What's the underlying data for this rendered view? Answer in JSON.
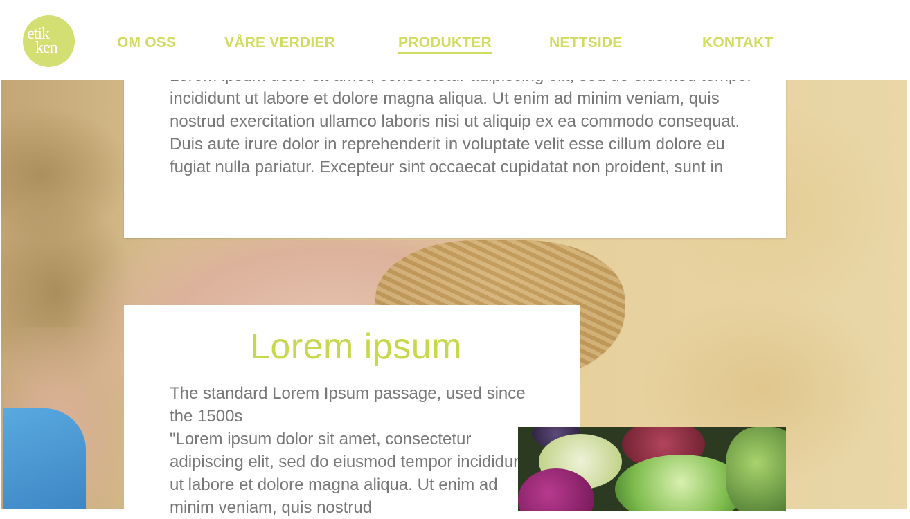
{
  "brand": {
    "logo_line1": "etik",
    "logo_line2": "ken",
    "accent_color": "#cfdc5e"
  },
  "nav": {
    "items": [
      {
        "label": "OM OSS"
      },
      {
        "label": "VÅRE VERDIER"
      },
      {
        "label": "PRODUKTER",
        "active": true
      },
      {
        "label": "NETTSIDE"
      },
      {
        "label": "KONTAKT"
      }
    ]
  },
  "section1": {
    "text": "Lorem ipsum dolor sit amet, consectetur adipiscing elit, sed do eiusmod tempor incididunt ut labore et dolore magna aliqua. Ut enim ad minim veniam, quis nostrud exercitation ullamco laboris nisi ut aliquip ex ea commodo consequat. Duis aute irure dolor in reprehenderit in voluptate velit esse cillum dolore eu fugiat nulla pariatur. Excepteur sint occaecat cupidatat non proident, sunt in"
  },
  "section2": {
    "heading": "Lorem ipsum",
    "subtitle": "The standard Lorem Ipsum passage, used since the 1500s",
    "body": "\"Lorem ipsum dolor sit amet, consectetur adipiscing elit, sed do eiusmod tempor incididunt ut labore et dolore magna aliqua. Ut enim ad minim veniam, quis nostrud"
  },
  "images": {
    "background": "hands-holding-grain-photo",
    "vegetables": "vegetables-photo"
  }
}
